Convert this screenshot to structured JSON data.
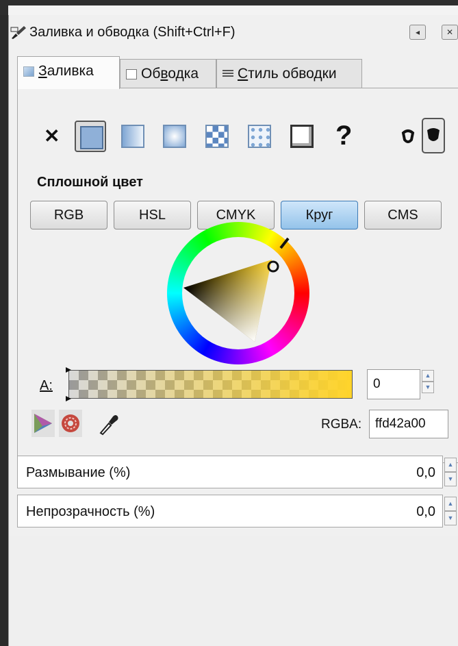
{
  "window": {
    "title": "Заливка и обводка (Shift+Ctrl+F)",
    "controls": [
      "collapse-icon",
      "close-icon"
    ]
  },
  "tabs": [
    {
      "label": "Заливка",
      "access_key": "З",
      "rest": "аливка",
      "active": true
    },
    {
      "label": "Обводка",
      "pre": "Об",
      "access_key": "в",
      "rest": "одка",
      "active": false
    },
    {
      "label": "Стиль обводки",
      "access_key": "С",
      "rest": "тиль обводки",
      "active": false
    }
  ],
  "paint_types": [
    {
      "name": "no-paint",
      "icon": "x-icon",
      "glyph": "✕"
    },
    {
      "name": "flat-color",
      "icon": "flat-color-icon",
      "selected": true
    },
    {
      "name": "linear-gradient",
      "icon": "linear-gradient-icon"
    },
    {
      "name": "radial-gradient",
      "icon": "radial-gradient-icon"
    },
    {
      "name": "pattern",
      "icon": "pattern-icon"
    },
    {
      "name": "swatch",
      "icon": "swatch-icon"
    },
    {
      "name": "unset",
      "icon": "question-icon",
      "glyph": "?"
    }
  ],
  "fill_rules": [
    {
      "name": "evenodd",
      "icon": "fill-evenodd-icon"
    },
    {
      "name": "nonzero",
      "icon": "fill-nonzero-icon",
      "selected": true
    }
  ],
  "section": {
    "label": "Сплошной цвет"
  },
  "color_modes": [
    {
      "label": "RGB",
      "active": false
    },
    {
      "label": "HSL",
      "active": false
    },
    {
      "label": "CMYK",
      "active": false
    },
    {
      "label": "Круг",
      "active": true
    },
    {
      "label": "CMS",
      "active": false
    }
  ],
  "alpha": {
    "label": "A:",
    "value": "0",
    "color": "#ffd42a"
  },
  "rgba": {
    "label": "RGBA:",
    "value": "ffd42a00"
  },
  "tools": [
    "color-managed-icon",
    "out-of-gamut-icon",
    "eyedropper-icon"
  ],
  "properties": [
    {
      "label": "Размывание (%)",
      "value": "0,0"
    },
    {
      "label": "Непрозрачность (%)",
      "value": "0,0"
    }
  ],
  "colors": {
    "selected_color": "#ffd42a",
    "active_button": "#94c3ea",
    "panel_bg": "#f0f0f0"
  }
}
